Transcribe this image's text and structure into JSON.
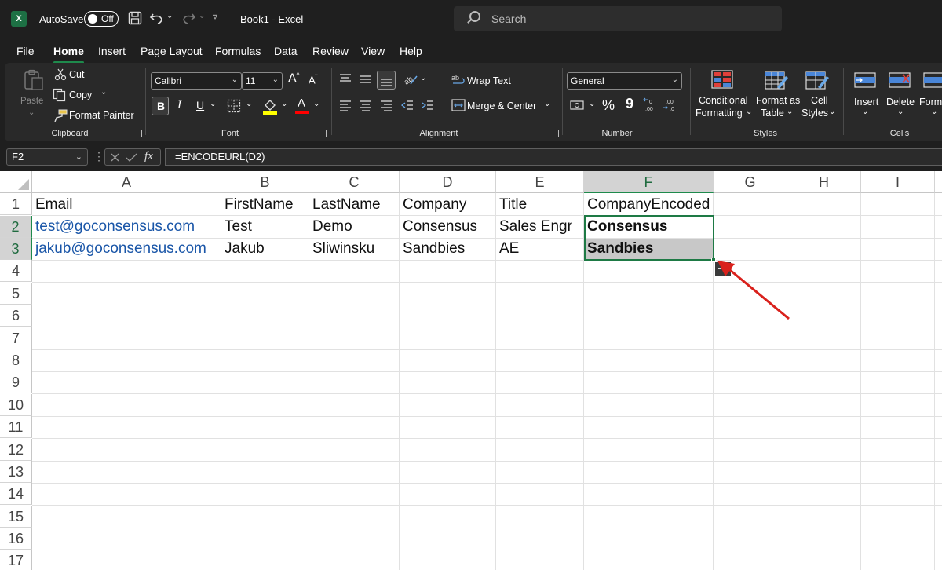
{
  "title_bar": {
    "app_logo": "X",
    "autosave_label": "AutoSave",
    "autosave_state": "Off",
    "document_title": "Book1  -  Excel",
    "search_placeholder": "Search"
  },
  "menu_tabs": [
    "File",
    "Home",
    "Insert",
    "Page Layout",
    "Formulas",
    "Data",
    "Review",
    "View",
    "Help"
  ],
  "active_tab": "Home",
  "ribbon": {
    "clipboard": {
      "paste": "Paste",
      "cut": "Cut",
      "copy": "Copy",
      "format_painter": "Format Painter",
      "group_label": "Clipboard"
    },
    "font": {
      "font_name": "Calibri",
      "font_size": "11",
      "bold": "B",
      "italic": "I",
      "underline": "U",
      "font_color_glyph": "A",
      "group_label": "Font",
      "highlight_color": "#ffff00",
      "font_color": "#ff0000"
    },
    "alignment": {
      "wrap_text": "Wrap Text",
      "merge_center": "Merge & Center",
      "group_label": "Alignment"
    },
    "number": {
      "format": "General",
      "percent": "%",
      "comma": "9",
      "group_label": "Number"
    },
    "styles": {
      "conditional_formatting_line1": "Conditional",
      "conditional_formatting_line2": "Formatting",
      "format_as_table_line1": "Format as",
      "format_as_table_line2": "Table",
      "cell_styles_line1": "Cell",
      "cell_styles_line2": "Styles",
      "group_label": "Styles"
    },
    "cells": {
      "insert": "Insert",
      "delete": "Delete",
      "format": "Format",
      "group_label": "Cells"
    }
  },
  "formula_bar": {
    "name_box": "F2",
    "formula": "=ENCODEURL(D2)"
  },
  "sheet": {
    "columns": [
      "A",
      "B",
      "C",
      "D",
      "E",
      "F",
      "G",
      "H",
      "I"
    ],
    "selected_column": "F",
    "rows": [
      "1",
      "2",
      "3",
      "4",
      "5",
      "6",
      "7",
      "8",
      "9",
      "10",
      "11",
      "12",
      "13",
      "14",
      "15",
      "16",
      "17"
    ],
    "selected_rows": [
      "2",
      "3"
    ],
    "data": [
      [
        "Email",
        "FirstName",
        "LastName",
        "Company",
        "Title",
        "CompanyEncoded"
      ],
      [
        "test@goconsensus.com",
        "Test",
        "Demo",
        "Consensus",
        "Sales Engr",
        "Consensus"
      ],
      [
        "jakub@goconsensus.com",
        "Jakub",
        "Sliwinsku",
        "Sandbies",
        "AE",
        "Sandbies"
      ]
    ]
  },
  "annotation": {
    "arrow_color": "#d9211c"
  }
}
